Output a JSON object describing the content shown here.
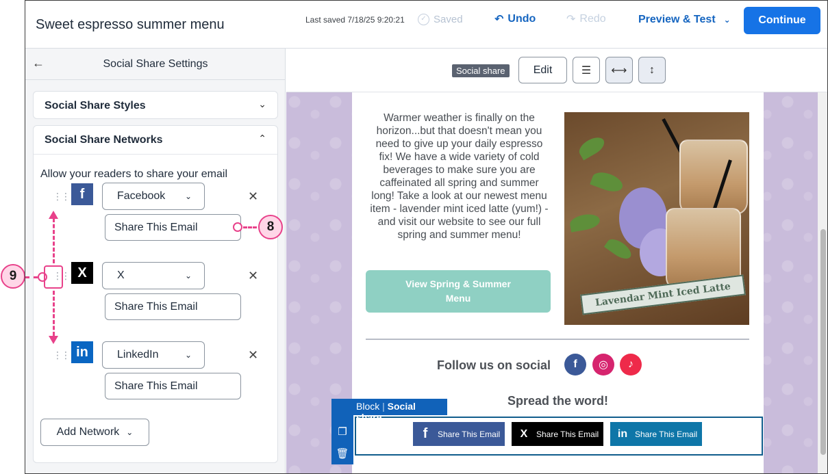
{
  "header": {
    "title": "Sweet espresso summer menu",
    "last_saved": "Last saved 7/18/25 9:20:21",
    "saved_label": "Saved",
    "undo_label": "Undo",
    "redo_label": "Redo",
    "preview_label": "Preview & Test",
    "continue_label": "Continue"
  },
  "panel": {
    "title": "Social Share Settings",
    "styles_label": "Social Share Styles",
    "networks_label": "Social Share Networks",
    "allow_text": "Allow your readers to share your email",
    "networks": [
      {
        "network": "Facebook",
        "icon": "f",
        "color": "#3b5998",
        "text": "Share This Email"
      },
      {
        "network": "X",
        "icon": "X",
        "color": "#000000",
        "text": "Share This Email"
      },
      {
        "network": "LinkedIn",
        "icon": "in",
        "color": "#0a66c2",
        "text": "Share This Email"
      }
    ],
    "add_network_label": "Add Network"
  },
  "canvas_toolbar": {
    "block_tag": "Social share",
    "edit_label": "Edit"
  },
  "email": {
    "intro_text": "Warmer weather is finally on the horizon...but that doesn't mean you need to give up your daily espresso fix! We have a wide variety of cold beverages to make sure you are caffeinated all spring and summer long! Take a look at our newest menu item - lavender mint iced latte (yum!) - and visit our website to see our full spring and summer menu!",
    "cta_label": "View Spring & Summer Menu",
    "image_banner": "Lavendar Mint Iced Latte",
    "follow_label": "Follow us on social",
    "spread_label": "Spread the word!",
    "block_label_prefix": "Block",
    "block_label_name": "Social share",
    "share_buttons": [
      {
        "label": "Share This Email",
        "icon": "f",
        "color": "#3b5998"
      },
      {
        "label": "Share This Email",
        "icon": "X",
        "color": "#000000"
      },
      {
        "label": "Share This Email",
        "icon": "in",
        "color": "#0e76a8"
      }
    ]
  },
  "callouts": {
    "eight": "8",
    "nine": "9"
  }
}
